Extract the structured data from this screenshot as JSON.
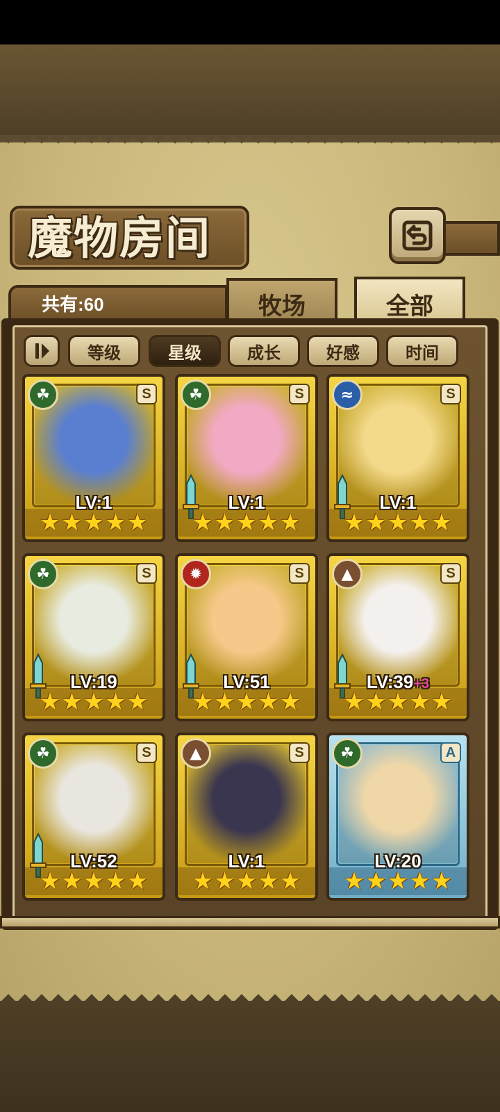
{
  "header": {
    "title": "魔物房间",
    "count_label": "共有:60"
  },
  "tabs": [
    {
      "label": "牧场",
      "active": false
    },
    {
      "label": "全部",
      "active": true
    }
  ],
  "sort": {
    "toggle_icon": "sort-order-icon",
    "buttons": [
      {
        "label": "等级",
        "active": false
      },
      {
        "label": "星级",
        "active": true
      },
      {
        "label": "成长",
        "active": false
      },
      {
        "label": "好感",
        "active": false
      },
      {
        "label": "时间",
        "active": false
      }
    ]
  },
  "monsters": [
    {
      "element": "leaf",
      "element_icon": "leaf-icon",
      "rank": "S",
      "level": "LV:1",
      "bonus": "",
      "stars": 5,
      "weapon": false,
      "color": "#5b7fd0"
    },
    {
      "element": "leaf",
      "element_icon": "leaf-icon",
      "rank": "S",
      "level": "LV:1",
      "bonus": "",
      "stars": 5,
      "weapon": true,
      "color": "#f2a9c4"
    },
    {
      "element": "water",
      "element_icon": "water-icon",
      "rank": "S",
      "level": "LV:1",
      "bonus": "",
      "stars": 5,
      "weapon": true,
      "color": "#f3d98a"
    },
    {
      "element": "leaf",
      "element_icon": "leaf-icon",
      "rank": "S",
      "level": "LV:19",
      "bonus": "",
      "stars": 5,
      "weapon": true,
      "color": "#e8ece0"
    },
    {
      "element": "fire",
      "element_icon": "fire-icon",
      "rank": "S",
      "level": "LV:51",
      "bonus": "",
      "stars": 5,
      "weapon": true,
      "color": "#f6c98a"
    },
    {
      "element": "earth",
      "element_icon": "earth-icon",
      "rank": "S",
      "level": "LV:39",
      "bonus": "+3",
      "stars": 5,
      "weapon": true,
      "color": "#f4f0ee"
    },
    {
      "element": "leaf",
      "element_icon": "leaf-icon",
      "rank": "S",
      "level": "LV:52",
      "bonus": "",
      "stars": 5,
      "weapon": true,
      "color": "#e9e6df"
    },
    {
      "element": "earth",
      "element_icon": "earth-icon",
      "rank": "S",
      "level": "LV:1",
      "bonus": "",
      "stars": 5,
      "weapon": false,
      "color": "#3a3650"
    },
    {
      "element": "leaf",
      "element_icon": "leaf-icon",
      "rank": "A",
      "level": "LV:20",
      "bonus": "",
      "stars": 5,
      "weapon": false,
      "color": "#efd7a8"
    }
  ],
  "colors": {
    "gold_frame": "#f5d544",
    "blue_frame": "#b8e2f0",
    "panel_dark": "#3a2814",
    "parchment": "#d9c98f",
    "star": "#ffd21c",
    "bonus": "#e24a9c"
  }
}
